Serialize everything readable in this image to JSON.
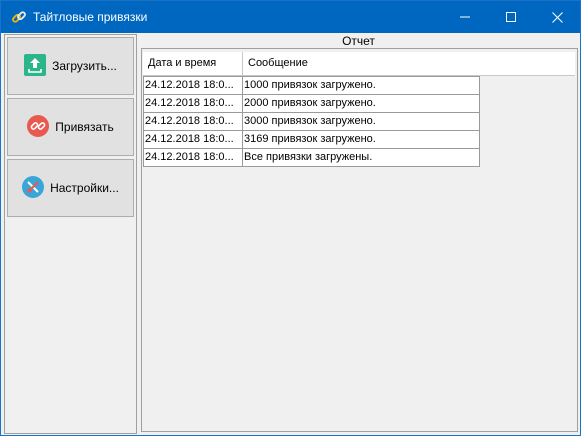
{
  "window": {
    "title": "Тайтловые привязки"
  },
  "buttons": {
    "load": "Загрузить...",
    "bind": "Привязать",
    "settings": "Настройки..."
  },
  "report": {
    "label": "Отчет",
    "columns": [
      "Дата и время",
      "Сообщение"
    ],
    "rows": [
      {
        "datetime": "24.12.2018 18:0...",
        "message": "1000 привязок загружено."
      },
      {
        "datetime": "24.12.2018 18:0...",
        "message": "2000 привязок загружено."
      },
      {
        "datetime": "24.12.2018 18:0...",
        "message": "3000 привязок загружено."
      },
      {
        "datetime": "24.12.2018 18:0...",
        "message": "3169 привязок загружено."
      },
      {
        "datetime": "24.12.2018 18:0...",
        "message": "Все привязки загружены."
      }
    ]
  },
  "icons": {
    "title": "link-icon",
    "load": "upload-icon",
    "bind": "broken-link-icon",
    "settings": "tools-icon"
  },
  "colors": {
    "titlebar": "#0067c0",
    "upload_icon": "#2bb58a",
    "bind_icon": "#e85a4f",
    "settings_icon": "#3aa6d8"
  }
}
